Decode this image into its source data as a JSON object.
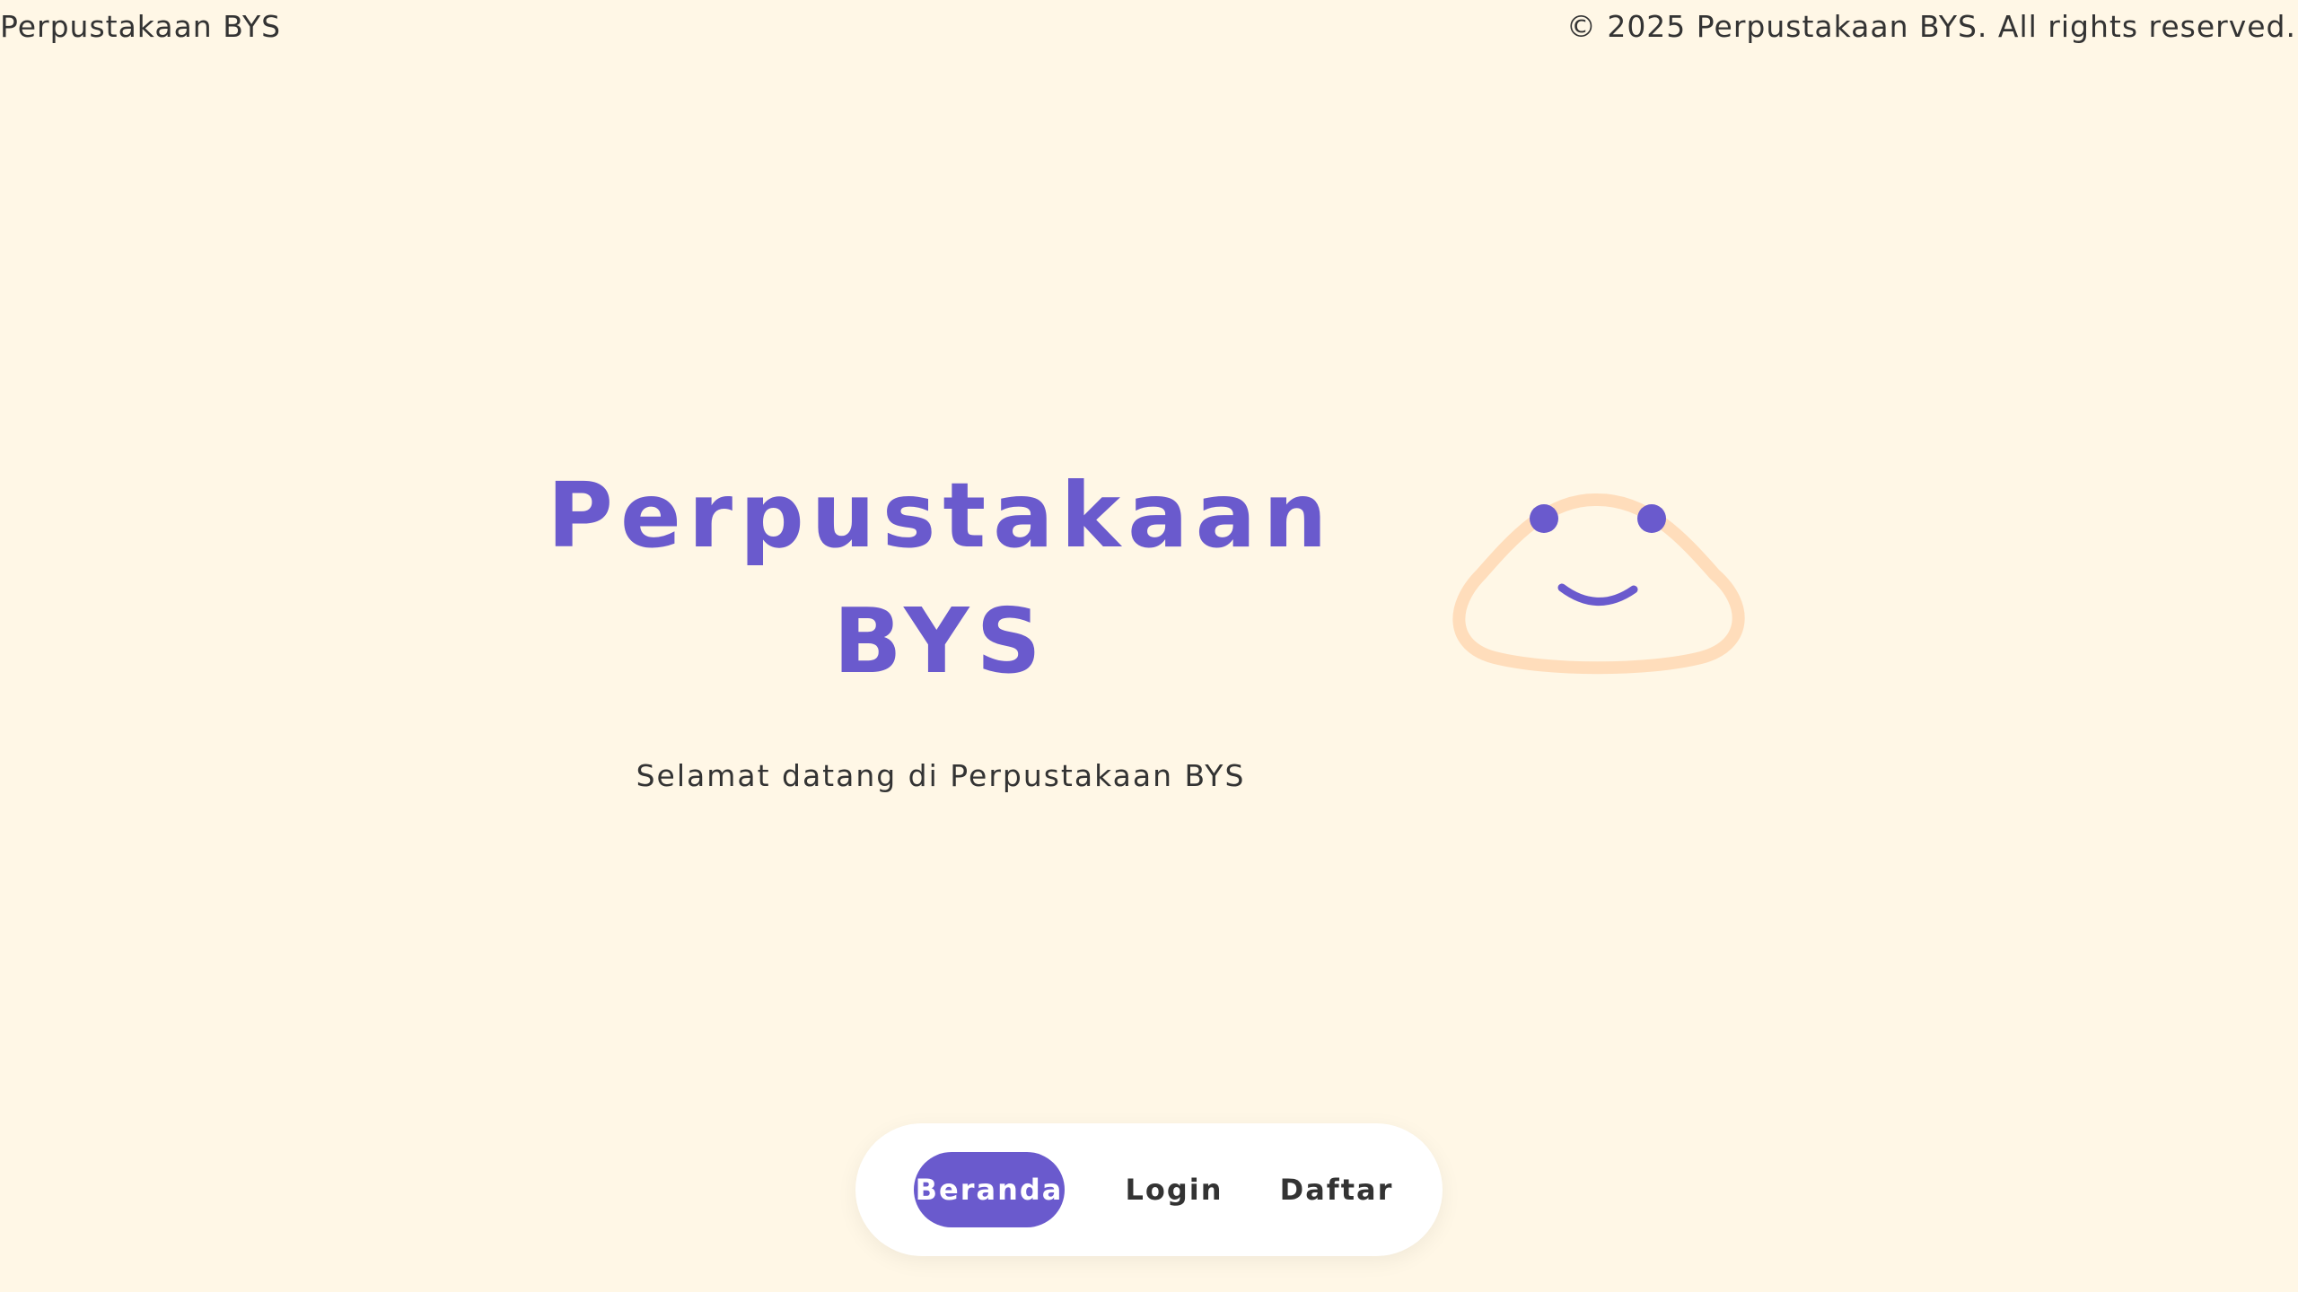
{
  "header": {
    "brand": "Perpustakaan BYS",
    "copyright": "© 2025 Perpustakaan BYS. All rights reserved."
  },
  "hero": {
    "title": "Perpustakaan BYS",
    "subtitle": "Selamat datang di Perpustakaan BYS"
  },
  "mascot": {
    "icon": "smiley-blob-icon",
    "outline_color": "#FFDDBB",
    "face_color": "#6A5ACD"
  },
  "nav": {
    "items": [
      {
        "label": "Beranda",
        "active": true
      },
      {
        "label": "Login",
        "active": false
      },
      {
        "label": "Daftar",
        "active": false
      }
    ]
  },
  "colors": {
    "background": "#FFF7E6",
    "accent": "#6A5ACD",
    "text": "#333333"
  }
}
